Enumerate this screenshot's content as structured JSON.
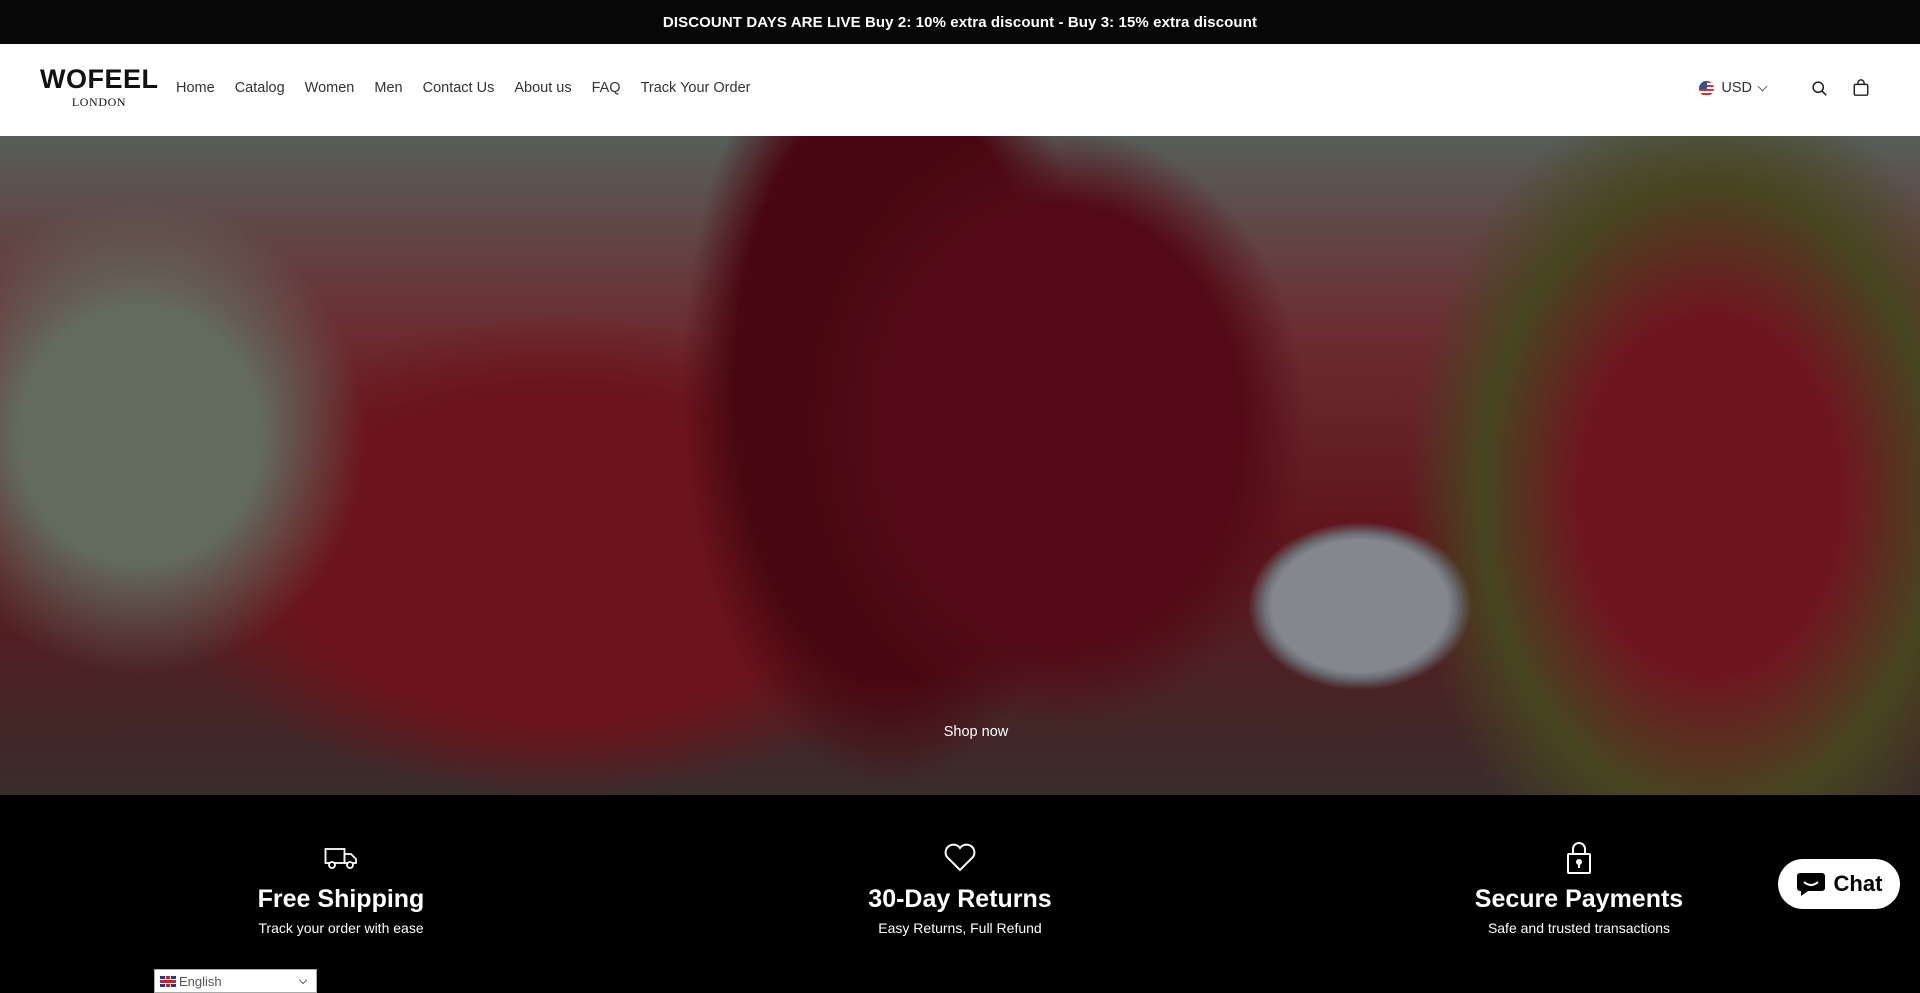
{
  "announcement": "DISCOUNT DAYS ARE LIVE Buy 2: 10% extra discount - Buy 3: 15% extra discount",
  "logo": {
    "brand": "WOFEEL",
    "sub": "LONDON"
  },
  "nav": [
    "Home",
    "Catalog",
    "Women",
    "Men",
    "Contact Us",
    "About us",
    "FAQ",
    "Track Your Order"
  ],
  "header": {
    "currency": "USD",
    "currency_flag_icon": "us-flag-icon",
    "search_icon": "search-icon",
    "cart_icon": "cart-icon"
  },
  "hero": {
    "cta": "Shop now"
  },
  "features": [
    {
      "icon": "truck-icon",
      "title": "Free Shipping",
      "text": "Track your order with ease"
    },
    {
      "icon": "heart-icon",
      "title": "30-Day Returns",
      "text": "Easy Returns, Full Refund"
    },
    {
      "icon": "lock-icon",
      "title": "Secure Payments",
      "text": "Safe and trusted transactions"
    }
  ],
  "chat": {
    "label": "Chat"
  },
  "language": {
    "selected": "English"
  }
}
